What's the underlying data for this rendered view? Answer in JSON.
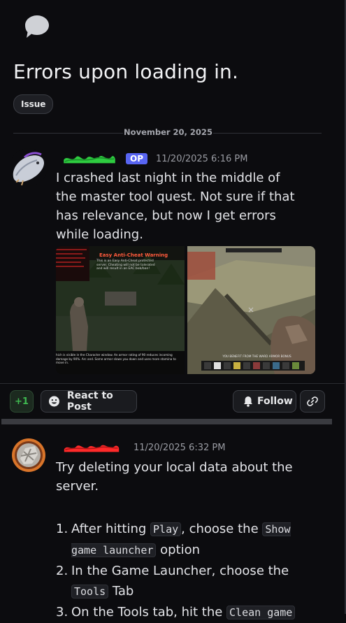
{
  "thread": {
    "title": "Errors upon loading in.",
    "tag": "Issue",
    "date_divider": "November 20, 2025"
  },
  "post": {
    "op_badge": "OP",
    "timestamp": "11/20/2025 6:16 PM",
    "text": "I crashed last night in the middle of the master tool quest. Not sure if that has relevance, but now I get errors while loading.",
    "attachments": [
      {
        "overlay_title": "Easy Anti-Cheat Warning",
        "overlay_lines": [
          "This is an Easy Anti-Cheat protected",
          "server. Cheating will not be tolerated",
          "and will result in an EAC bob/ban!"
        ],
        "caption": "hich is visible in the Character window. An armor rating of 90 reduces incoming damage by 90%. Arc and. Some armor slows you down and uses more stamina to move in."
      },
      {
        "caption": "YOU BENEFIT FROM THE WARD ARMOR BONUS"
      }
    ]
  },
  "actions": {
    "plus_one": "+1",
    "react_label": "React to Post",
    "follow_label": "Follow"
  },
  "reply": {
    "timestamp": "11/20/2025 6:32 PM",
    "intro": "Try deleting your local data about the server.",
    "steps": [
      {
        "num": "1.",
        "pre": "After hitting ",
        "code1": "Play",
        "mid": ", choose the ",
        "code2": "Show game launcher",
        "post": " option"
      },
      {
        "num": "2.",
        "pre": "In the Game Launcher, choose the ",
        "code1": "Tools",
        "post": " Tab"
      },
      {
        "num": "3.",
        "pre": "On the Tools tab, hit the ",
        "code1": "Clean game"
      }
    ]
  },
  "colors": {
    "background": "#0c0c0f",
    "op_badge": "#5865f2",
    "plus_one": "#3fb950",
    "name_scribble_op": "#2ecc40",
    "name_scribble_reply": "#ff2a2a"
  },
  "icons": [
    "chat-bubble-icon",
    "smiley-icon",
    "bell-icon",
    "link-icon"
  ]
}
